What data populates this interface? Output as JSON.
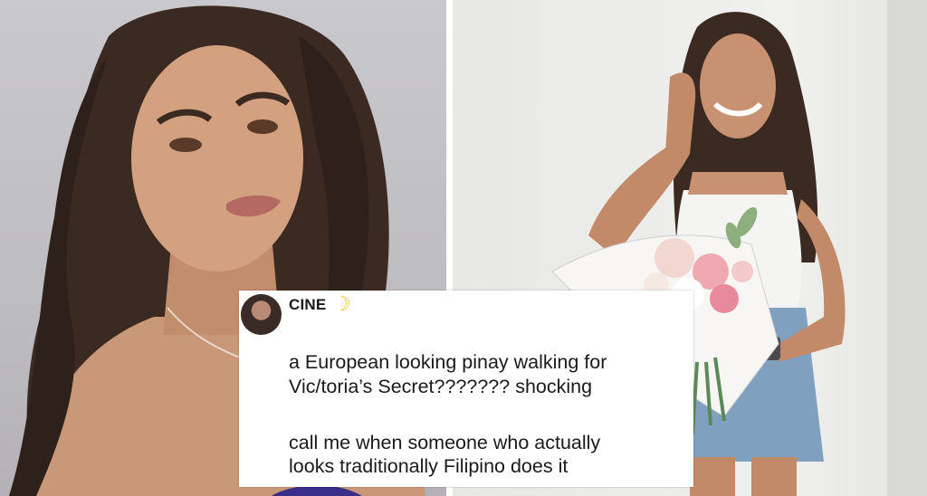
{
  "post": {
    "username": "CINE",
    "username_icon": "crescent-moon-icon",
    "paragraph1": [
      "a European looking pinay walking for",
      "Vic/toria’s Secret??????? shocking"
    ],
    "paragraph2": [
      "call me when someone who actually",
      "looks traditionally Filipino does it"
    ]
  },
  "colors": {
    "card_background": "#ffffff",
    "text": "#1a1a1a",
    "moon": "#f5c542"
  }
}
